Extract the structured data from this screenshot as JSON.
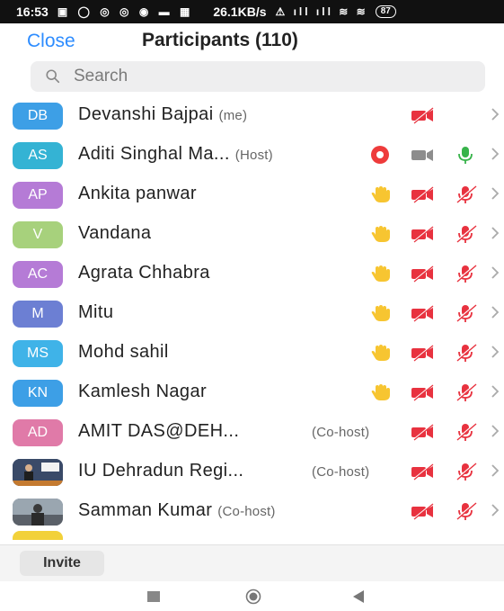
{
  "status_bar": {
    "time": "16:53",
    "left_icons": "▣ ◯ ◎ ◎ ◉ ▬ ▦",
    "network_speed": "26.1KB/s",
    "right_icons": "⚠ ıll ıll ≋ ≋",
    "battery": "87"
  },
  "header": {
    "close_label": "Close",
    "title": "Participants (110)"
  },
  "search": {
    "placeholder": "Search"
  },
  "colors": {
    "accent": "#2d8cff",
    "muted_red": "#e8323f",
    "raise_hand": "#f7c531",
    "mic_green": "#37b34a",
    "record_red": "#ee3b3b"
  },
  "participants": [
    {
      "initials": "DB",
      "name": "Devanshi Bajpai",
      "tag": "(me)",
      "avatar_color": "#3d9fe6"
    },
    {
      "initials": "AS",
      "name": "Aditi Singhal Ma...",
      "tag": "(Host)",
      "avatar_color": "#34b3d4"
    },
    {
      "initials": "AP",
      "name": "Ankita panwar",
      "tag": "",
      "avatar_color": "#b57bd6"
    },
    {
      "initials": "V",
      "name": "Vandana",
      "tag": "",
      "avatar_color": "#a7d17c"
    },
    {
      "initials": "AC",
      "name": "Agrata Chhabra",
      "tag": "",
      "avatar_color": "#b57bd6"
    },
    {
      "initials": "M",
      "name": "Mitu",
      "tag": "",
      "avatar_color": "#6c7fd3"
    },
    {
      "initials": "MS",
      "name": "Mohd sahil",
      "tag": "",
      "avatar_color": "#3fb3e8"
    },
    {
      "initials": "KN",
      "name": "Kamlesh Nagar",
      "tag": "",
      "avatar_color": "#3d9fe6"
    },
    {
      "initials": "AD",
      "name": "AMIT DAS@DEH...",
      "tag": "(Co-host)",
      "avatar_color": "#e07aa8"
    },
    {
      "initials": "",
      "name": "IU Dehradun Regi...",
      "tag": "(Co-host)",
      "avatar_color": "#4a5a78"
    },
    {
      "initials": "",
      "name": "Samman Kumar",
      "tag": "(Co-host)",
      "avatar_color": "#6a7a8a"
    }
  ],
  "footer": {
    "invite_label": "Invite"
  }
}
